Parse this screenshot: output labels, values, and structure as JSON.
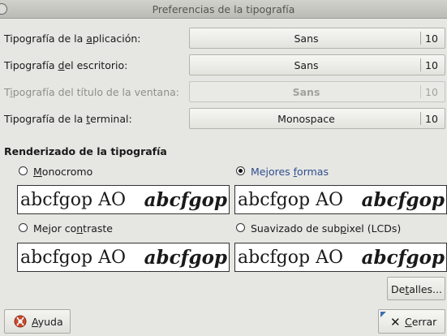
{
  "window": {
    "title": "Preferencias de la tipografía"
  },
  "rows": [
    {
      "label_pre": "Tipografía de la ",
      "label_u": "a",
      "label_post": "plicación:",
      "font": "Sans",
      "size": "10",
      "disabled": false
    },
    {
      "label_pre": "Tipografía ",
      "label_u": "d",
      "label_post": "el escritorio:",
      "font": "Sans",
      "size": "10",
      "disabled": false
    },
    {
      "label_pre": "T",
      "label_u": "i",
      "label_post": "pografía del título de la ventana:",
      "font": "Sans",
      "size": "10",
      "disabled": true
    },
    {
      "label_pre": "Tipografía de la ",
      "label_u": "t",
      "label_post": "erminal:",
      "font": "Monospace",
      "size": "10",
      "disabled": false
    }
  ],
  "rendering": {
    "title": "Renderizado de la tipografía",
    "sample_normal": "abcfgop AO",
    "sample_bold": "abcfgop",
    "options": [
      {
        "pre": "",
        "u": "M",
        "post": "onocromo",
        "selected": false
      },
      {
        "pre": "Mejores ",
        "u": "f",
        "post": "ormas",
        "selected": true
      },
      {
        "pre": "Mejor co",
        "u": "n",
        "post": "traste",
        "selected": false
      },
      {
        "pre": "Suavizado de sub",
        "u": "p",
        "post": "ixel (LCDs)",
        "selected": false
      }
    ]
  },
  "buttons": {
    "details_pre": "De",
    "details_u": "t",
    "details_post": "alles...",
    "help_u": "A",
    "help_post": "yuda",
    "close_u": "C",
    "close_post": "errar"
  },
  "colors": {
    "selected_label": "#2f4f8f",
    "help_icon": "#d9482a"
  }
}
